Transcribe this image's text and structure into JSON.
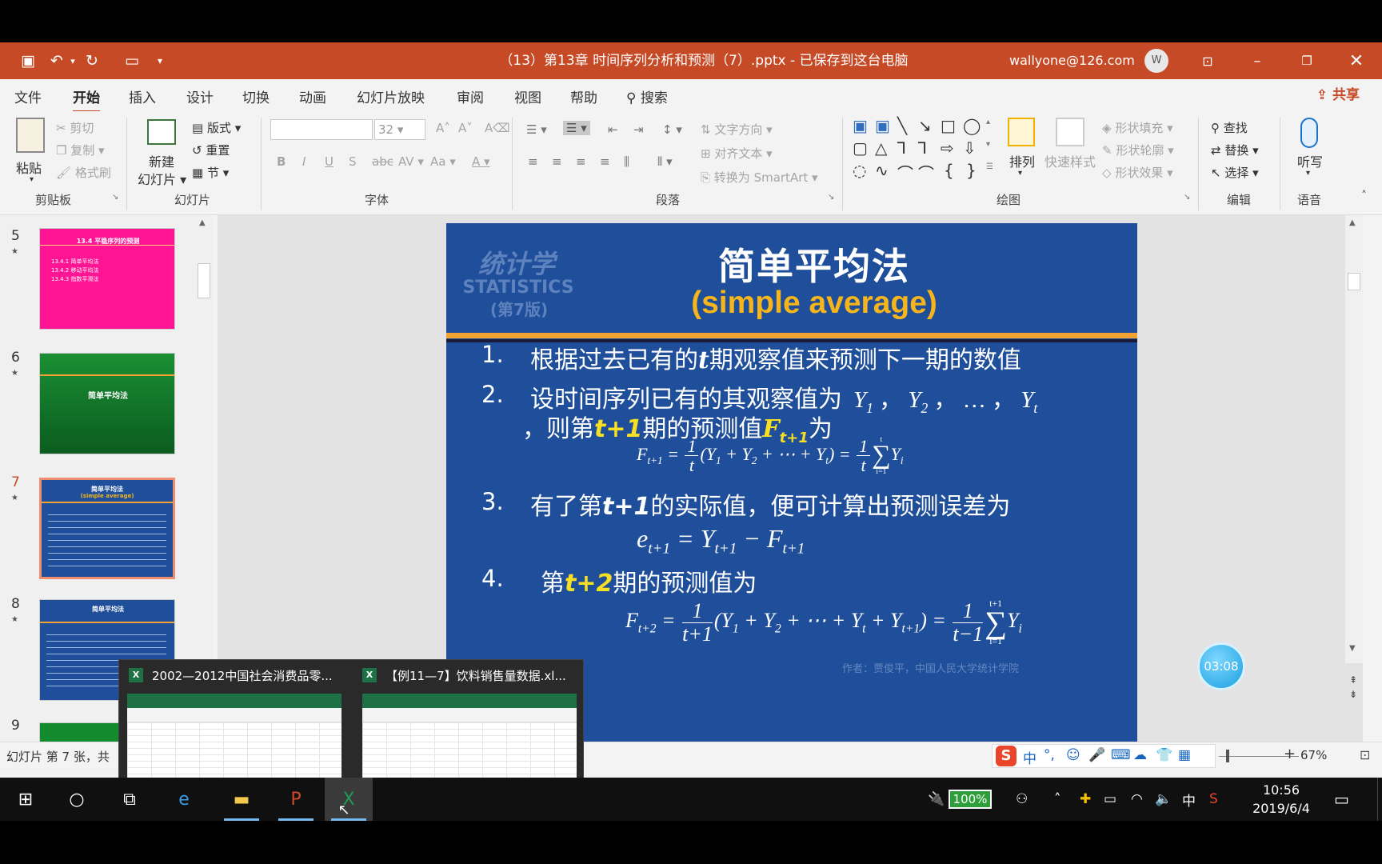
{
  "window": {
    "title": "（13）第13章 时间序列分析和预测（7）.pptx - 已保存到这台电脑",
    "account": "wallyone@126.com",
    "avatar_letter": "W"
  },
  "ribbon_tabs": [
    "文件",
    "开始",
    "插入",
    "设计",
    "切换",
    "动画",
    "幻灯片放映",
    "审阅",
    "视图",
    "帮助",
    "搜索"
  ],
  "share_label": "共享",
  "ribbon": {
    "clipboard": {
      "paste": "粘贴",
      "cut": "剪切",
      "copy": "复制",
      "format_painter": "格式刷",
      "label": "剪贴板"
    },
    "slides": {
      "new_slide_1": "新建",
      "new_slide_2": "幻灯片",
      "layout": "版式",
      "reset": "重置",
      "section": "节",
      "label": "幻灯片"
    },
    "font": {
      "size": "32",
      "label": "字体"
    },
    "paragraph": {
      "text_direction": "文字方向",
      "align_text": "对齐文本",
      "smartart": "转换为 SmartArt",
      "label": "段落"
    },
    "drawing": {
      "arrange": "排列",
      "quick_styles": "快速样式",
      "shape_fill": "形状填充",
      "shape_outline": "形状轮廓",
      "shape_effects": "形状效果",
      "label": "绘图"
    },
    "editing": {
      "find": "查找",
      "replace": "替换",
      "select": "选择",
      "label": "编辑"
    },
    "voice": {
      "dictate": "听写",
      "label": "语音"
    }
  },
  "thumbnails": [
    {
      "num": "5",
      "title": "13.4  平稳序列的预测",
      "lines": [
        "13.4.1  简单平均法",
        "13.4.2  移动平均法",
        "13.4.3  指数平滑法"
      ]
    },
    {
      "num": "6",
      "title": "简单平均法"
    },
    {
      "num": "7",
      "title": "简单平均法",
      "subtitle": "(simple average)"
    },
    {
      "num": "8",
      "title": "简单平均法"
    },
    {
      "num": "9"
    }
  ],
  "slide": {
    "watermark_cn": "统计学",
    "watermark_en": "STATISTICS",
    "watermark_ed": "(第7版)",
    "title": "简单平均法",
    "subtitle": "(simple average)",
    "items": [
      {
        "num": "1.",
        "text_a": "根据过去已有的",
        "t": "t",
        "text_b": "期观察值来预测下一期的数值"
      },
      {
        "num": "2.",
        "text_a": "设时间序列已有的其观察值为",
        "sep": "，",
        "ellipsis": "…",
        "text_b": "，则第",
        "t1": "t+1",
        "text_c": "期的预测值",
        "text_d": "为"
      },
      {
        "num": "3.",
        "text_a": "有了第",
        "t1": "t+1",
        "text_b": "的实际值，便可计算出预测误差为"
      },
      {
        "num": "4.",
        "text_a": "第",
        "t2": "t+2",
        "text_b": "期的预测值为"
      }
    ],
    "author": "作者：贾俊平，中国人民大学统计学院"
  },
  "timer": "03:08",
  "status": {
    "text": "幻灯片 第 7 张，共",
    "zoom": "67%"
  },
  "ime": {
    "lang": "中"
  },
  "preview": {
    "items": [
      {
        "title": "2002—2012中国社会消费品零..."
      },
      {
        "title": "【例11—7】饮料销售量数据.xl..."
      }
    ]
  },
  "tray": {
    "battery": "100%",
    "ime_lang": "中",
    "time": "10:56",
    "date": "2019/6/4"
  },
  "colors": {
    "accent": "#c74a26",
    "slide_bg": "#1f4e9a",
    "subtitle": "#f7b51c",
    "thumb5": "#ff1493",
    "thumb6": "#138a2e"
  }
}
